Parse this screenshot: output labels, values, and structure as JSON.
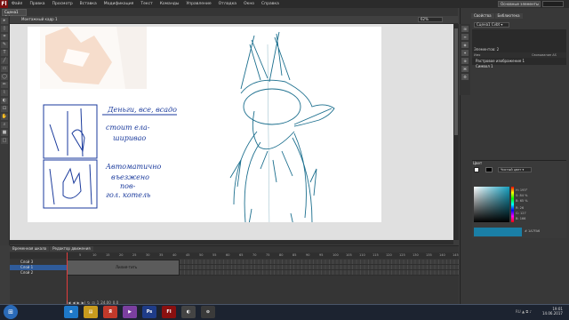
{
  "app": {
    "logo": "Fl",
    "menu": [
      "Файл",
      "Правка",
      "Просмотр",
      "Вставка",
      "Модификация",
      "Текст",
      "Команды",
      "Управление",
      "Отладка",
      "Окно",
      "Справка"
    ],
    "workspace": "Основные элементы ▾",
    "document_tab": "Сцена1 Cvbt",
    "scene_label": "Монтажный кадр 1",
    "zoom": "62%"
  },
  "tools": [
    "▸",
    "◊",
    "⌗",
    "✎",
    "T",
    "╱",
    "▭",
    "◯",
    "✏",
    "⌇",
    "◐",
    "⊡",
    "✋",
    "⌕",
    "■",
    "□"
  ],
  "timeline": {
    "tabs": [
      "Временная шкала",
      "Редактор движения"
    ],
    "frame_numbers": [
      "5",
      "10",
      "15",
      "20",
      "25",
      "30",
      "35",
      "40",
      "45",
      "50",
      "55",
      "60",
      "65",
      "70",
      "75",
      "80",
      "85",
      "90",
      "95",
      "100",
      "105",
      "110",
      "115",
      "120",
      "125",
      "130",
      "135",
      "140",
      "145"
    ],
    "layers": [
      "Слой 3",
      "Слой 1",
      "Слой 2"
    ],
    "key_text": "Лилия-тить",
    "controls": [
      "|◀",
      "◀",
      "▶",
      "▶|",
      "↻",
      "⊡",
      "1",
      "24.00",
      "0.0"
    ]
  },
  "right_panel": {
    "tabs": [
      "Свойства",
      "Библиотека"
    ],
    "library_select": "Сцена1 Cvbt ▾",
    "library_count": "Элементов: 2",
    "library_headers": [
      "Имя",
      "Связывание AS"
    ],
    "library_items": [
      "Растровое изображение 1",
      "Символ 1"
    ],
    "icon_strip": [
      "⊞",
      "≡",
      "◈",
      "✦",
      "⊕",
      "⌘",
      "⚙"
    ],
    "color": {
      "tab": "Цвет",
      "type": "Чистый цвет ▾",
      "hsb": [
        "H: 193°",
        "S: 84 %",
        "B: 65 %",
        "R: 26",
        "G: 127",
        "B: 166"
      ],
      "hex": "# 1A7FA6",
      "accent": "#1a7fa6"
    }
  },
  "taskbar": {
    "apps": [
      {
        "label": "e",
        "color": "#1e78c8"
      },
      {
        "label": "▤",
        "color": "#c89b1e"
      },
      {
        "label": "Я",
        "color": "#c0392b"
      },
      {
        "label": "▶",
        "color": "#7b3fa0"
      },
      {
        "label": "Ps",
        "color": "#1f3c88"
      },
      {
        "label": "Fl",
        "color": "#8a1010"
      },
      {
        "label": "◐",
        "color": "#444"
      },
      {
        "label": "⊙",
        "color": "#3a3a3a"
      }
    ],
    "time": "19:01",
    "date": "14.06.2017",
    "tray": "RU ▲ ⧉ ♪"
  },
  "stage": {
    "notes": [
      "Деньги, все, всадо",
      "стоит ела-",
      "ширивао",
      "Автоматично",
      "въезжено",
      "пов-",
      "гол. котель"
    ]
  }
}
